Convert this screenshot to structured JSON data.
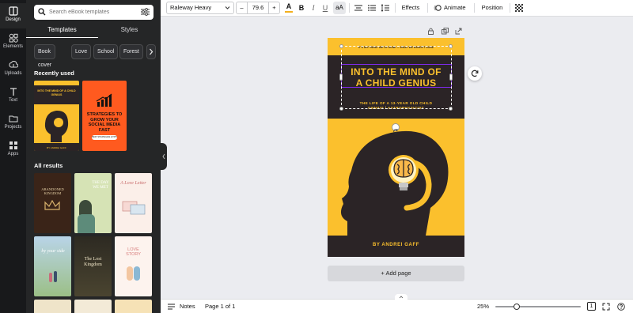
{
  "rail": [
    {
      "label": "Design",
      "icon": "design-icon"
    },
    {
      "label": "Elements",
      "icon": "elements-icon"
    },
    {
      "label": "Uploads",
      "icon": "uploads-icon"
    },
    {
      "label": "Text",
      "icon": "text-icon"
    },
    {
      "label": "Projects",
      "icon": "projects-icon"
    },
    {
      "label": "Apps",
      "icon": "apps-icon"
    }
  ],
  "panel": {
    "search_placeholder": "Search eBook templates",
    "tabs": [
      "Templates",
      "Styles"
    ],
    "chips": [
      "Book cover",
      "Love",
      "School",
      "Forest"
    ],
    "recently_used_title": "Recently used",
    "all_results_title": "All results",
    "recent": [
      {
        "title": "INTO THE MIND OF A CHILD GENIUS",
        "author": "BY ANDREI GAFF"
      },
      {
        "title": "STRATEGIES TO GROW YOUR SOCIAL MEDIA FAST",
        "button": "BEST STRATEGIES & TIPS"
      }
    ],
    "results": [
      {
        "title": "ABANDONED KINGDOM"
      },
      {
        "title": "THE DAY WE MET"
      },
      {
        "title": "A Love Letter"
      },
      {
        "title": "by your side"
      },
      {
        "title": "The Lost Kingdom"
      },
      {
        "title": "LOVE STORY"
      }
    ]
  },
  "toolbar": {
    "font": "Raleway Heavy",
    "minus": "–",
    "size": "79.6",
    "plus": "+",
    "font_color_label": "A",
    "bold_label": "B",
    "italic_label": "I",
    "underline_label": "U",
    "case_label": "aA",
    "effects": "Effects",
    "animate": "Animate",
    "position": "Position"
  },
  "cover": {
    "tiny_text": "IT'S NOT WHAT WE'VE DONE — WHAT WE HAVEN'T DONE",
    "title_line1": "INTO THE MIND OF",
    "title_line2": "A CHILD GENIUS",
    "subtitle_line1": "THE LIFE OF A 13-YEAR OLD CHILD",
    "subtitle_line2": "GENIUS / ASTROPHYSICIST",
    "author": "BY ANDREI GAFF"
  },
  "canvas": {
    "add_page": "+ Add page"
  },
  "bottombar": {
    "notes": "Notes",
    "page_indicator": "Page 1 of 1",
    "zoom": "25%",
    "zoom_fraction": 0.25,
    "page_number_badge": "1"
  },
  "colors": {
    "rail_bg": "#18191b",
    "panel_bg": "#252627",
    "cover_yellow": "#fbc02d",
    "cover_dark": "#2b2426",
    "accent_purple": "#7d2ae8"
  }
}
